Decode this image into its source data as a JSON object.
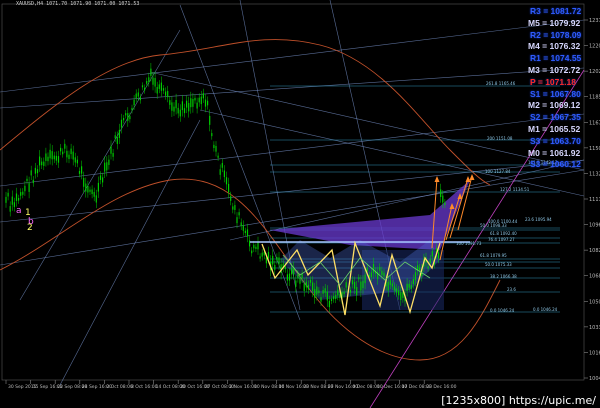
{
  "chart_data": {
    "type": "candlestick",
    "title": "XAUUSD,H4",
    "title_ohlc": "1071.70 1071.90 1071.00 1071.53",
    "colors": {
      "background": "#000000",
      "candle": "#00d000",
      "envelope": "#c0502a",
      "channel": "#7f9bd6",
      "harmonic": "#ffe066",
      "harmonic_fill": "#6a3ad0",
      "projection": "#ff8a2a",
      "level_line": "#4d7fff",
      "fib_line": "#3aaed8"
    },
    "y_ticks": [
      "1237.",
      "1220.",
      "1202.",
      "1185.",
      "1167.",
      "1150.",
      "1132.",
      "1111.",
      "1096.",
      "1082.",
      "1068.",
      "1050.",
      "1033.",
      "1016.",
      "1004."
    ],
    "x_ticks": [
      "30 Sep 2015",
      "15 Sep 16:00",
      "22 Sep 08:00",
      "28 Sep 16:00",
      "2 Oct 08:00",
      "8 Oct 16:00",
      "14 Oct 08:00",
      "20 Oct 16:00",
      "27 Oct 08:00",
      "2 Nov 16:00",
      "10 Nov 08:00",
      "16 Nov 16:00",
      "23 Nov 08:00",
      "27 Nov 16:00",
      "4 Dec 08:00",
      "10 Dec 16:00",
      "17 Dec 08:00",
      "23 Dec 16:00"
    ],
    "pivot_levels": [
      {
        "label": "R3 = 1081.72",
        "color": "#2f5cff",
        "highlight": true
      },
      {
        "label": "M5 = 1079.92",
        "color": "#d8d8ff",
        "highlight": false
      },
      {
        "label": "R2 = 1078.09",
        "color": "#2f5cff",
        "highlight": true
      },
      {
        "label": "M4 = 1076.32",
        "color": "#d8d8ff",
        "highlight": false
      },
      {
        "label": "R1 = 1074.55",
        "color": "#2f5cff",
        "highlight": true
      },
      {
        "label": "M3 = 1072.72",
        "color": "#d8d8ff",
        "highlight": false
      },
      {
        "label": "P = 1071.18",
        "color": "#ff2a2a",
        "highlight": true
      },
      {
        "label": "S1 = 1067.80",
        "color": "#2f5cff",
        "highlight": true
      },
      {
        "label": "M2 = 1069.12",
        "color": "#d8d8ff",
        "highlight": false
      },
      {
        "label": "S2 = 1067.35",
        "color": "#2f5cff",
        "highlight": true
      },
      {
        "label": "M1 = 1065.52",
        "color": "#d8d8ff",
        "highlight": false
      },
      {
        "label": "S3 = 1063.70",
        "color": "#2f5cff",
        "highlight": true
      },
      {
        "label": "M0 = 1061.92",
        "color": "#d8d8ff",
        "highlight": false
      },
      {
        "label": "S3 = 1060.12",
        "color": "#2f5cff",
        "highlight": true
      }
    ],
    "fib_labels": [
      "261.8 1165.46",
      "200 1151.08",
      "161.8 1142.17",
      "127.2 1134.51",
      "100 1127.84",
      "100.0 1100.44",
      "50.0 1098.33",
      "76.4 1097.27",
      "61.8 1092.40",
      "100 1091.73",
      "23.6 1095.94",
      "61.8 1079.95",
      "50.0 1075.33",
      "38.2 1066.38",
      "23.6",
      "0.0 1046.24",
      "0.0 1046.24"
    ],
    "wave_labels": [
      "a",
      "b",
      "1",
      "2"
    ],
    "watermark": "[1235x800] https://upic.me/"
  }
}
